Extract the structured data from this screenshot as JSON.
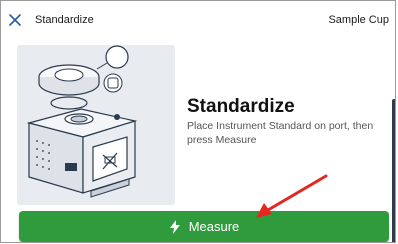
{
  "header": {
    "title": "Standardize",
    "right_label": "Sample Cup",
    "close_icon": "close-icon"
  },
  "main": {
    "title": "Standardize",
    "description": "Place Instrument Standard on port, then press Measure",
    "illustration_icon": "instrument-illustration"
  },
  "actions": {
    "measure_label": "Measure",
    "measure_icon": "bolt-icon"
  },
  "colors": {
    "accent_green": "#2f9b3d",
    "illustration_bg": "#e8ebef",
    "annotation_red": "#e52620"
  }
}
